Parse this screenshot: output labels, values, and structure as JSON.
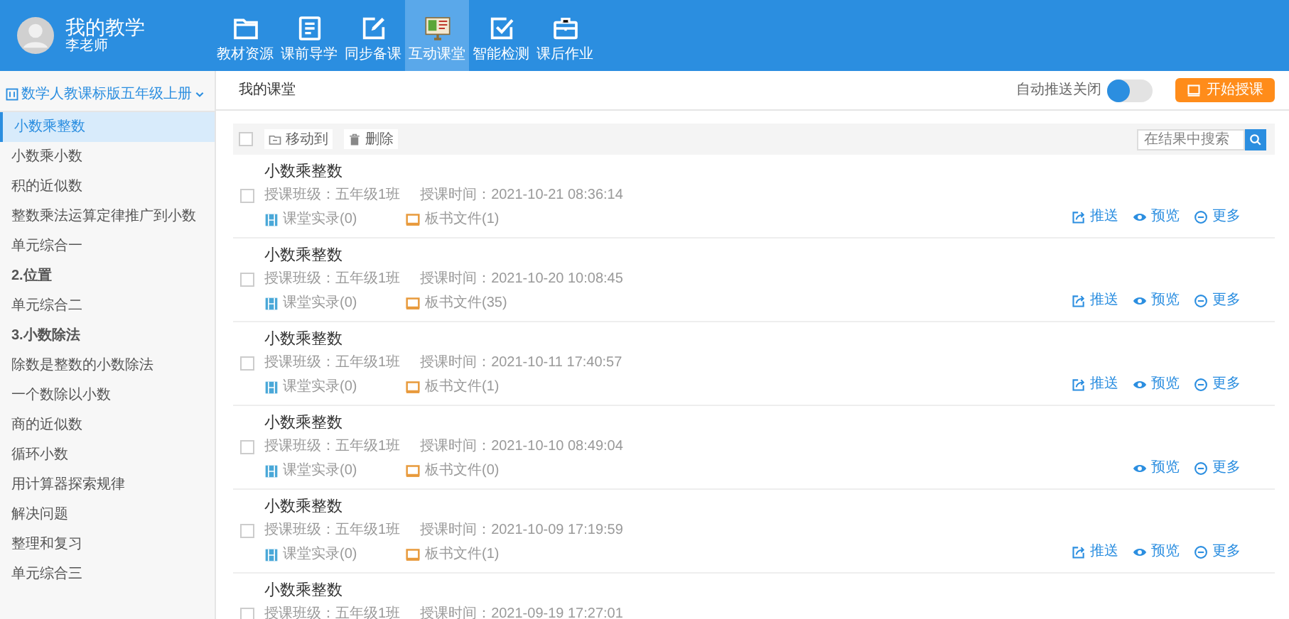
{
  "header": {
    "title": "我的教学",
    "user": "李老师",
    "nav": [
      {
        "label": "教材资源",
        "selected": false
      },
      {
        "label": "课前导学",
        "selected": false
      },
      {
        "label": "同步备课",
        "selected": false
      },
      {
        "label": "互动课堂",
        "selected": true
      },
      {
        "label": "智能检测",
        "selected": false
      },
      {
        "label": "课后作业",
        "selected": false
      }
    ]
  },
  "sidebar": {
    "book": "数学人教课标版五年级上册",
    "items": [
      {
        "label": "小数乘整数",
        "kind": "item",
        "selected": true
      },
      {
        "label": "小数乘小数",
        "kind": "item",
        "selected": false
      },
      {
        "label": "积的近似数",
        "kind": "item",
        "selected": false
      },
      {
        "label": "整数乘法运算定律推广到小数",
        "kind": "item",
        "selected": false
      },
      {
        "label": "单元综合一",
        "kind": "item",
        "selected": false
      },
      {
        "label": "2.位置",
        "kind": "heading",
        "selected": false
      },
      {
        "label": "单元综合二",
        "kind": "item",
        "selected": false
      },
      {
        "label": "3.小数除法",
        "kind": "heading",
        "selected": false
      },
      {
        "label": "除数是整数的小数除法",
        "kind": "item",
        "selected": false
      },
      {
        "label": "一个数除以小数",
        "kind": "item",
        "selected": false
      },
      {
        "label": "商的近似数",
        "kind": "item",
        "selected": false
      },
      {
        "label": "循环小数",
        "kind": "item",
        "selected": false
      },
      {
        "label": "用计算器探索规律",
        "kind": "item",
        "selected": false
      },
      {
        "label": "解决问题",
        "kind": "item",
        "selected": false
      },
      {
        "label": "整理和复习",
        "kind": "item",
        "selected": false
      },
      {
        "label": "单元综合三",
        "kind": "item",
        "selected": false
      }
    ]
  },
  "page": {
    "title": "我的课堂",
    "auto_push": {
      "label": "自动推送关闭",
      "on": false
    },
    "start_button": "开始授课"
  },
  "toolbar": {
    "checked": false,
    "move": "移动到",
    "delete": "删除",
    "search": {
      "placeholder": "在结果中搜索"
    }
  },
  "lessons": [
    {
      "title": "小数乘整数",
      "checked": false,
      "class_info": "授课班级：五年级1班",
      "time": "授课时间：2021-10-21 08:36:14",
      "records": "课堂实录(0)",
      "files": "板书文件(1)",
      "actions": [
        {
          "kind": "push",
          "label": "推送"
        },
        {
          "kind": "preview",
          "label": "预览"
        },
        {
          "kind": "more",
          "label": "更多"
        }
      ]
    },
    {
      "title": "小数乘整数",
      "checked": false,
      "class_info": "授课班级：五年级1班",
      "time": "授课时间：2021-10-20 10:08:45",
      "records": "课堂实录(0)",
      "files": "板书文件(35)",
      "actions": [
        {
          "kind": "push",
          "label": "推送"
        },
        {
          "kind": "preview",
          "label": "预览"
        },
        {
          "kind": "more",
          "label": "更多"
        }
      ]
    },
    {
      "title": "小数乘整数",
      "checked": false,
      "class_info": "授课班级：五年级1班",
      "time": "授课时间：2021-10-11 17:40:57",
      "records": "课堂实录(0)",
      "files": "板书文件(1)",
      "actions": [
        {
          "kind": "push",
          "label": "推送"
        },
        {
          "kind": "preview",
          "label": "预览"
        },
        {
          "kind": "more",
          "label": "更多"
        }
      ]
    },
    {
      "title": "小数乘整数",
      "checked": false,
      "class_info": "授课班级：五年级1班",
      "time": "授课时间：2021-10-10 08:49:04",
      "records": "课堂实录(0)",
      "files": "板书文件(0)",
      "actions": [
        {
          "kind": "preview",
          "label": "预览"
        },
        {
          "kind": "more",
          "label": "更多"
        }
      ]
    },
    {
      "title": "小数乘整数",
      "checked": false,
      "class_info": "授课班级：五年级1班",
      "time": "授课时间：2021-10-09 17:19:59",
      "records": "课堂实录(0)",
      "files": "板书文件(1)",
      "actions": [
        {
          "kind": "push",
          "label": "推送"
        },
        {
          "kind": "preview",
          "label": "预览"
        },
        {
          "kind": "more",
          "label": "更多"
        }
      ]
    },
    {
      "title": "小数乘整数",
      "checked": false,
      "class_info": "授课班级：五年级1班",
      "time": "授课时间：2021-09-19 17:27:01"
    }
  ]
}
